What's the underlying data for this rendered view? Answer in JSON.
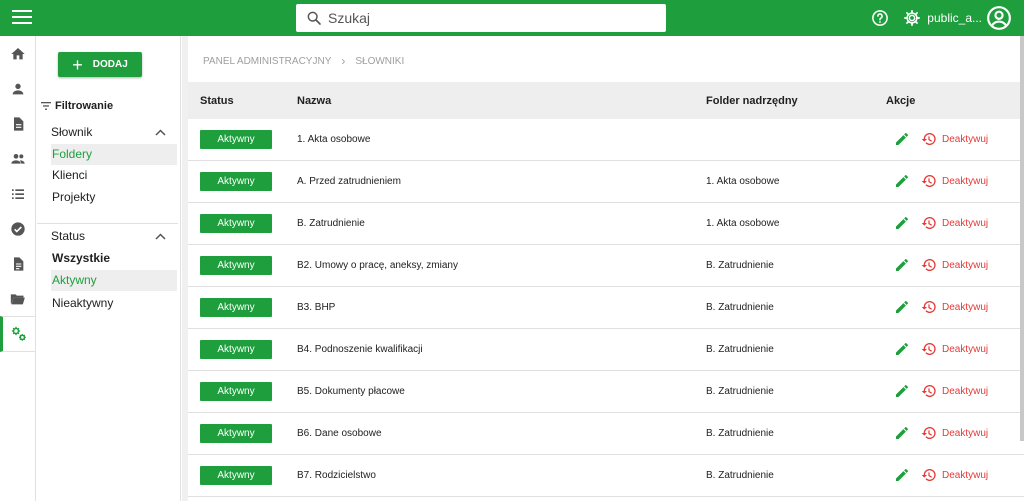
{
  "header": {
    "search_placeholder": "Szukaj",
    "user_label": "public_a...",
    "accent": "#1f9e3e"
  },
  "rail": {
    "items": [
      {
        "icon": "home-icon"
      },
      {
        "icon": "person-icon"
      },
      {
        "icon": "document-icon"
      },
      {
        "icon": "people-icon"
      },
      {
        "icon": "list-icon"
      },
      {
        "icon": "check-circle-icon"
      },
      {
        "icon": "file-icon"
      },
      {
        "icon": "folder-open-icon"
      },
      {
        "icon": "settings-gears-icon",
        "active": true
      }
    ]
  },
  "filter": {
    "add_label": "DODAJ",
    "title": "Filtrowanie",
    "section1": {
      "label": "Słownik",
      "options": [
        "Foldery",
        "Klienci",
        "Projekty"
      ]
    },
    "section2": {
      "label": "Status",
      "options": [
        "Wszystkie",
        "Aktywny",
        "Nieaktywny"
      ]
    }
  },
  "breadcrumb": {
    "items": [
      "PANEL ADMINISTRACYJNY",
      "SŁOWNIKI"
    ]
  },
  "table": {
    "headers": {
      "status": "Status",
      "name": "Nazwa",
      "parent": "Folder nadrzędny",
      "actions": "Akcje"
    },
    "rows": [
      {
        "status": "Aktywny",
        "name": "1. Akta osobowe",
        "parent": "",
        "action": "Deaktywuj"
      },
      {
        "status": "Aktywny",
        "name": "A. Przed zatrudnieniem",
        "parent": "1. Akta osobowe",
        "action": "Deaktywuj"
      },
      {
        "status": "Aktywny",
        "name": "B. Zatrudnienie",
        "parent": "1. Akta osobowe",
        "action": "Deaktywuj"
      },
      {
        "status": "Aktywny",
        "name": "B2. Umowy o pracę, aneksy, zmiany",
        "parent": "B. Zatrudnienie",
        "action": "Deaktywuj"
      },
      {
        "status": "Aktywny",
        "name": "B3. BHP",
        "parent": "B. Zatrudnienie",
        "action": "Deaktywuj"
      },
      {
        "status": "Aktywny",
        "name": "B4. Podnoszenie kwalifikacji",
        "parent": "B. Zatrudnienie",
        "action": "Deaktywuj"
      },
      {
        "status": "Aktywny",
        "name": "B5. Dokumenty płacowe",
        "parent": "B. Zatrudnienie",
        "action": "Deaktywuj"
      },
      {
        "status": "Aktywny",
        "name": "B6. Dane osobowe",
        "parent": "B. Zatrudnienie",
        "action": "Deaktywuj"
      },
      {
        "status": "Aktywny",
        "name": "B7. Rodzicielstwo",
        "parent": "B. Zatrudnienie",
        "action": "Deaktywuj"
      }
    ]
  }
}
